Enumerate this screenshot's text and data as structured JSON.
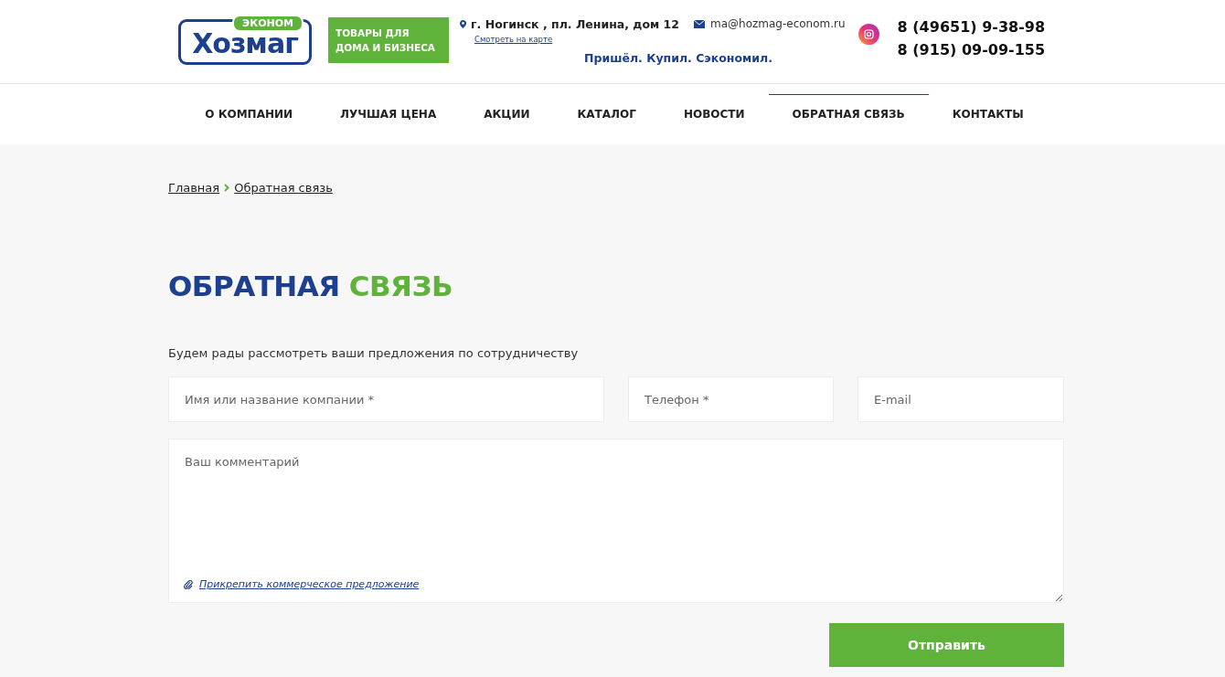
{
  "logo": {
    "badge": "ЭКОНОМ",
    "name": "Хозмаг"
  },
  "slogan_box": "ТОВАРЫ ДЛЯ ДОМА И БИЗНЕСА",
  "address": "г. Ногинск , пл. Ленина, дом 12",
  "map_link": "Смотреть на карте",
  "email": "ma@hozmag-econom.ru",
  "tagline": "Пришёл. Купил. Сэкономил.",
  "phones": [
    "8 (49651) 9-38-98",
    "8 (915) 09-09-155"
  ],
  "nav": [
    {
      "label": "О КОМПАНИИ",
      "selected": false
    },
    {
      "label": "ЛУЧШАЯ ЦЕНА",
      "selected": false
    },
    {
      "label": "АКЦИИ",
      "selected": false
    },
    {
      "label": "КАТАЛОГ",
      "selected": false
    },
    {
      "label": "НОВОСТИ",
      "selected": false
    },
    {
      "label": "ОБРАТНАЯ СВЯЗЬ",
      "selected": true
    },
    {
      "label": "КОНТАКТЫ",
      "selected": false
    }
  ],
  "breadcrumbs": [
    "Главная",
    "Обратная связь"
  ],
  "heading": {
    "first": "ОБРАТНАЯ",
    "second": "СВЯЗЬ"
  },
  "intro": "Будем рады рассмотреть ваши предложения по сотрудничеству",
  "form": {
    "fields": [
      {
        "placeholder": "Имя или название компании *"
      },
      {
        "placeholder": "Телефон *"
      },
      {
        "placeholder": "E-mail"
      }
    ],
    "comment": {
      "placeholder": "Ваш комментарий"
    },
    "attach_link": "Прикрепить коммерческое предложение",
    "submit": "Отправить"
  }
}
